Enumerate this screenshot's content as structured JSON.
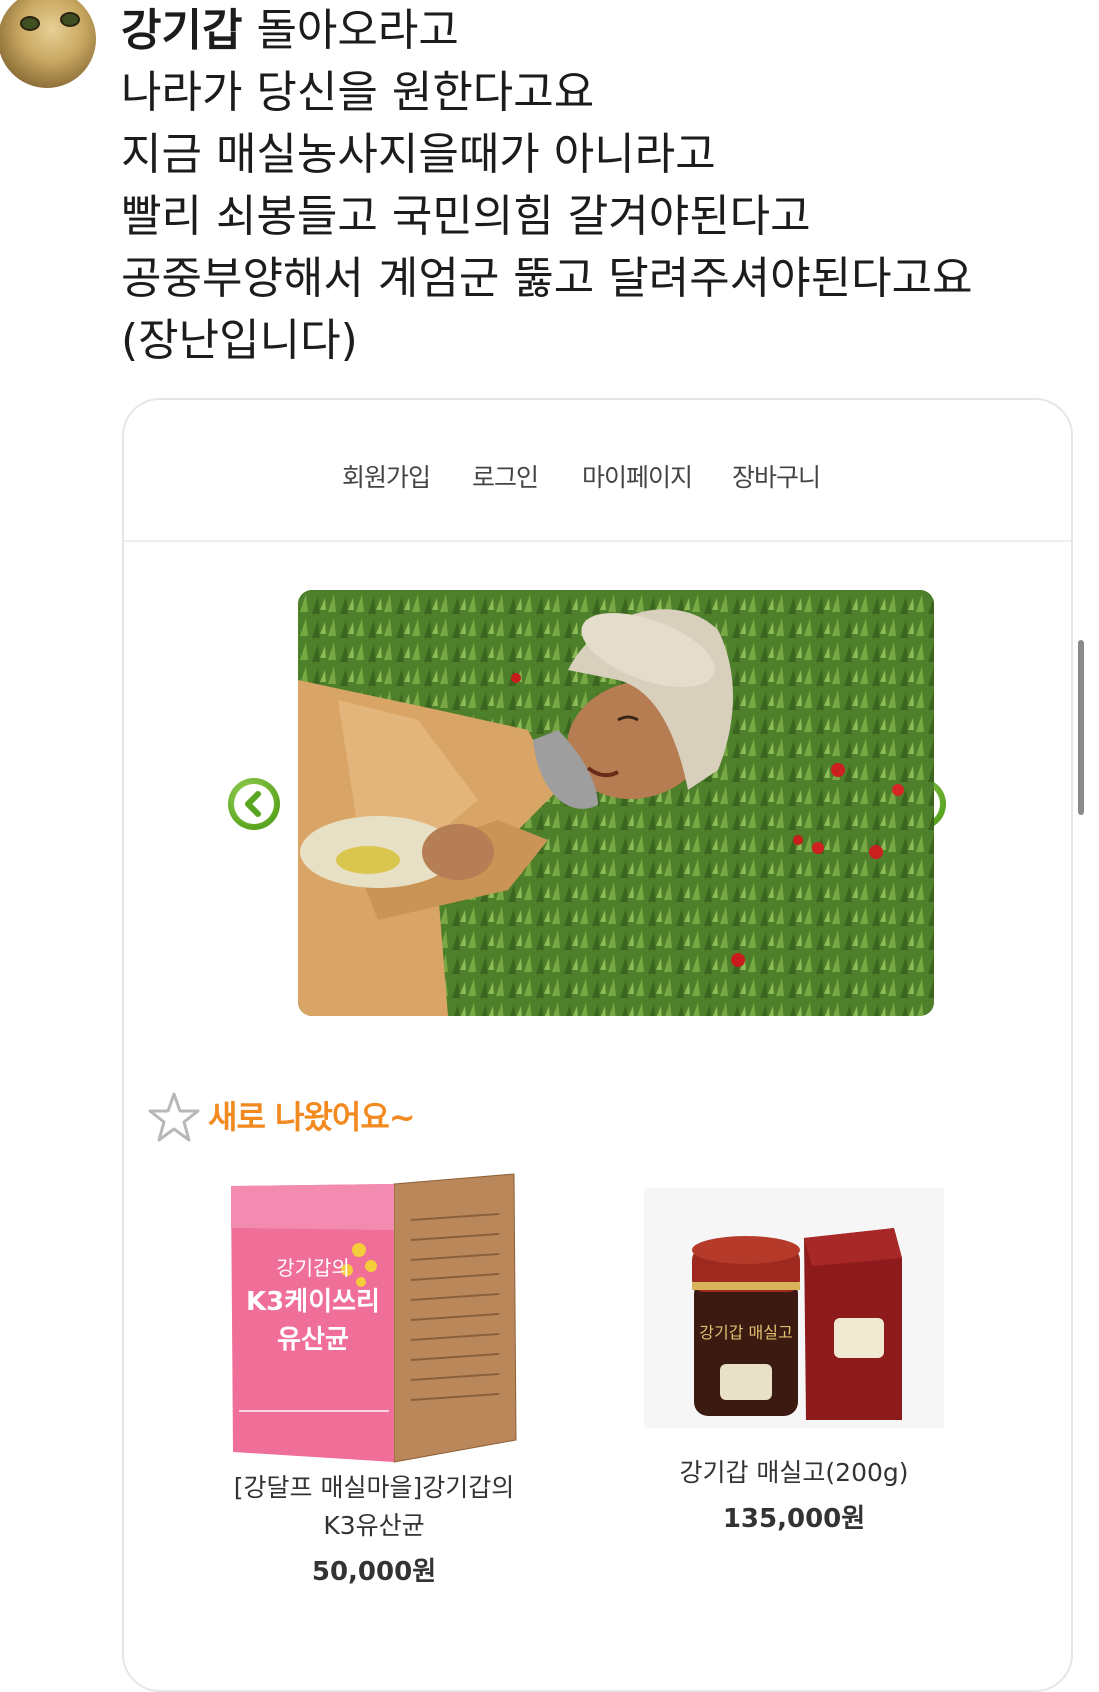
{
  "post": {
    "author": "강기갑",
    "lines": [
      "돌아오라고",
      "나라가 당신을 원한다고요",
      "지금 매실농사지을때가 아니라고",
      "빨리 쇠봉들고 국민의힘 갈겨야된다고",
      "공중부양해서 계엄군 뚫고 달려주셔야된다고요",
      "(장난입니다)"
    ]
  },
  "shop": {
    "nav": [
      "회원가입",
      "로그인",
      "마이페이지",
      "장바구니"
    ],
    "section_title": "새로 나왔어요~",
    "products": [
      {
        "name_line1": "[강달프 매실마을]강기갑의",
        "name_line2": "K3유산균",
        "price": "50,000원",
        "box_title1": "강기갑의",
        "box_title2": "K3케이쓰리",
        "box_title3": "유산균"
      },
      {
        "name_line1": "강기갑 매실고(200g)",
        "price": "135,000원",
        "jar_label": "강기갑 매실고"
      }
    ]
  },
  "colors": {
    "accent_orange": "#f28a1f",
    "arrow_green": "#5aa520",
    "pink_box": "#ef6f98",
    "dark_red_box": "#8e1b1b"
  },
  "icons": [
    "avatar-cat",
    "chevron-left-icon",
    "chevron-right-icon",
    "star-outline-icon"
  ]
}
